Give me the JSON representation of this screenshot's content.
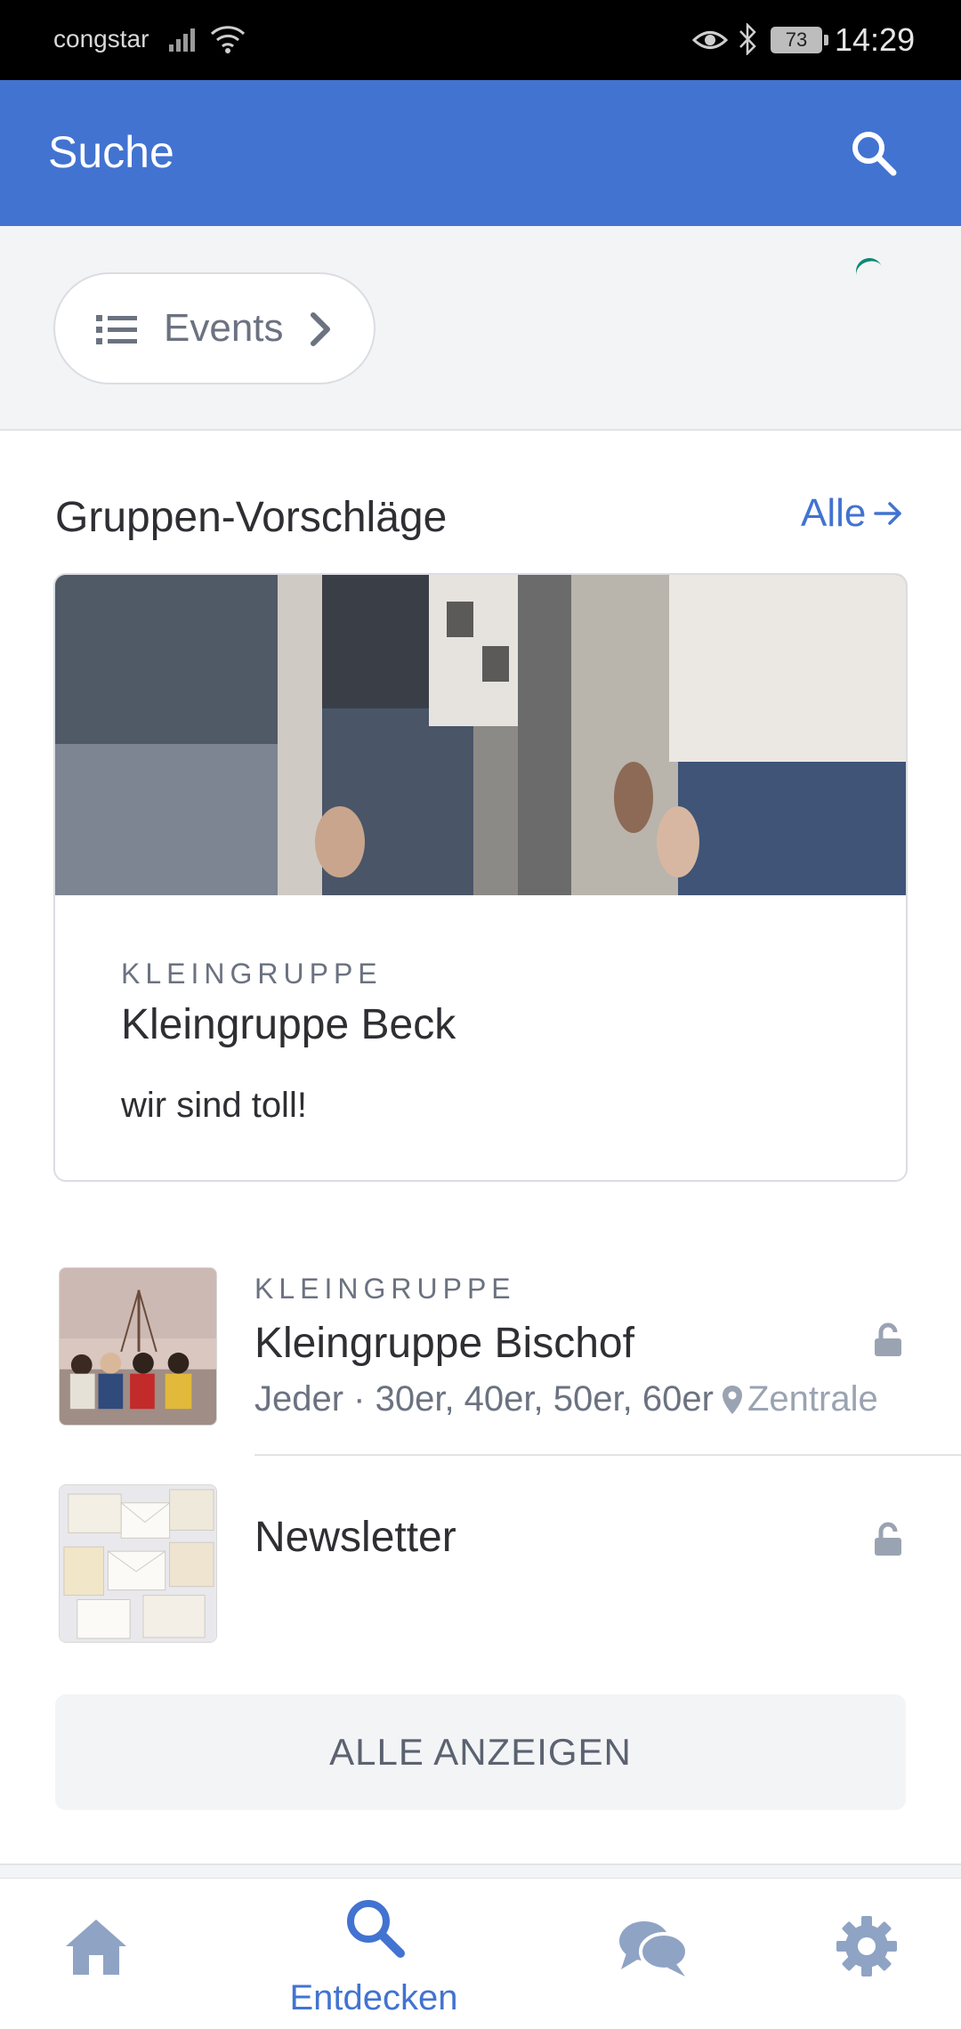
{
  "status_bar": {
    "carrier": "congstar",
    "battery": "73",
    "time": "14:29"
  },
  "app_bar": {
    "title": "Suche",
    "search_icon": "search-icon"
  },
  "filter": {
    "chip_label": "Events",
    "chip_icon": "list-icon",
    "chip_chevron": "chevron-right-icon"
  },
  "groups": {
    "section_title": "Gruppen-Vorschläge",
    "all_link": "Alle",
    "featured": {
      "kicker": "KLEINGRUPPE",
      "title": "Kleingruppe Beck",
      "description": "wir sind toll!"
    },
    "items": [
      {
        "kicker": "KLEINGRUPPE",
        "title": "Kleingruppe Bischof",
        "meta": "Jeder · 30er, 40er, 50er, 60er",
        "location": "Zentrale",
        "lock_icon": "lock-icon"
      },
      {
        "kicker": "",
        "title": "Newsletter",
        "meta": "",
        "location": "",
        "lock_icon": "lock-icon"
      }
    ],
    "show_all_label": "ALLE ANZEIGEN"
  },
  "bottom_nav": {
    "items": [
      {
        "icon": "home-icon",
        "label": ""
      },
      {
        "icon": "search-icon",
        "label": "Entdecken",
        "active": true
      },
      {
        "icon": "chat-icon",
        "label": ""
      },
      {
        "icon": "gear-icon",
        "label": ""
      }
    ]
  },
  "colors": {
    "primary": "#4273d1",
    "inactive_icon": "#8fa3c4",
    "text": "#2e2e33",
    "muted": "#6b7280"
  }
}
